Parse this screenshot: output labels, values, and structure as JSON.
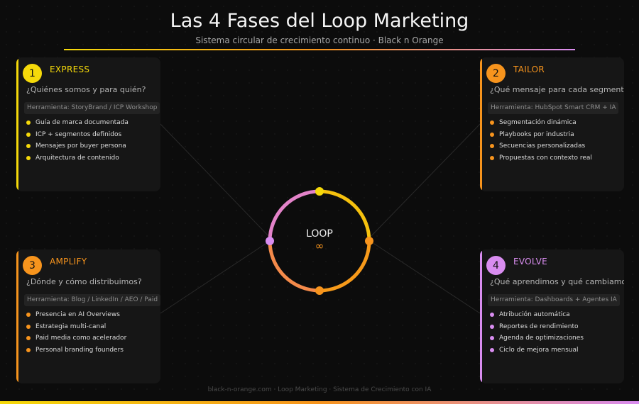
{
  "header": {
    "title": "Las 4 Fases del Loop Marketing",
    "subtitle": "Sistema circular de crecimiento continuo · Black n Orange"
  },
  "colors": {
    "yellow": "#f5d90a",
    "orange": "#f7941d",
    "pink": "#d98df0",
    "background": "#0c0c0c",
    "card": "#161616"
  },
  "phases": [
    {
      "number": "1",
      "name": "EXPRESS",
      "color": "#f5d90a",
      "question": "¿Quiénes somos y para quién?",
      "tool": "Herramienta: StoryBrand / ICP Workshop",
      "items": [
        "Guía de marca documentada",
        "ICP + segmentos definidos",
        "Mensajes por buyer persona",
        "Arquitectura de contenido"
      ]
    },
    {
      "number": "2",
      "name": "TAILOR",
      "color": "#f7941d",
      "question": "¿Qué mensaje para cada segmento?",
      "tool": "Herramienta: HubSpot Smart CRM + IA",
      "items": [
        "Segmentación dinámica",
        "Playbooks por industria",
        "Secuencias personalizadas",
        "Propuestas con contexto real"
      ]
    },
    {
      "number": "3",
      "name": "AMPLIFY",
      "color": "#f7941d",
      "question": "¿Dónde y cómo distribuimos?",
      "tool": "Herramienta: Blog / LinkedIn / AEO / Paid",
      "items": [
        "Presencia en AI Overviews",
        "Estrategia multi-canal",
        "Paid media como acelerador",
        "Personal branding founders"
      ]
    },
    {
      "number": "4",
      "name": "EVOLVE",
      "color": "#d98df0",
      "question": "¿Qué aprendimos y qué cambiamos?",
      "tool": "Herramienta: Dashboards + Agentes IA",
      "items": [
        "Atribución automática",
        "Reportes de rendimiento",
        "Agenda de optimizaciones",
        "Ciclo de mejora mensual"
      ]
    }
  ],
  "loop": {
    "label": "LOOP",
    "symbol": "∞"
  },
  "footer": {
    "text": "black-n-orange.com · Loop Marketing · Sistema de Crecimiento con IA"
  }
}
